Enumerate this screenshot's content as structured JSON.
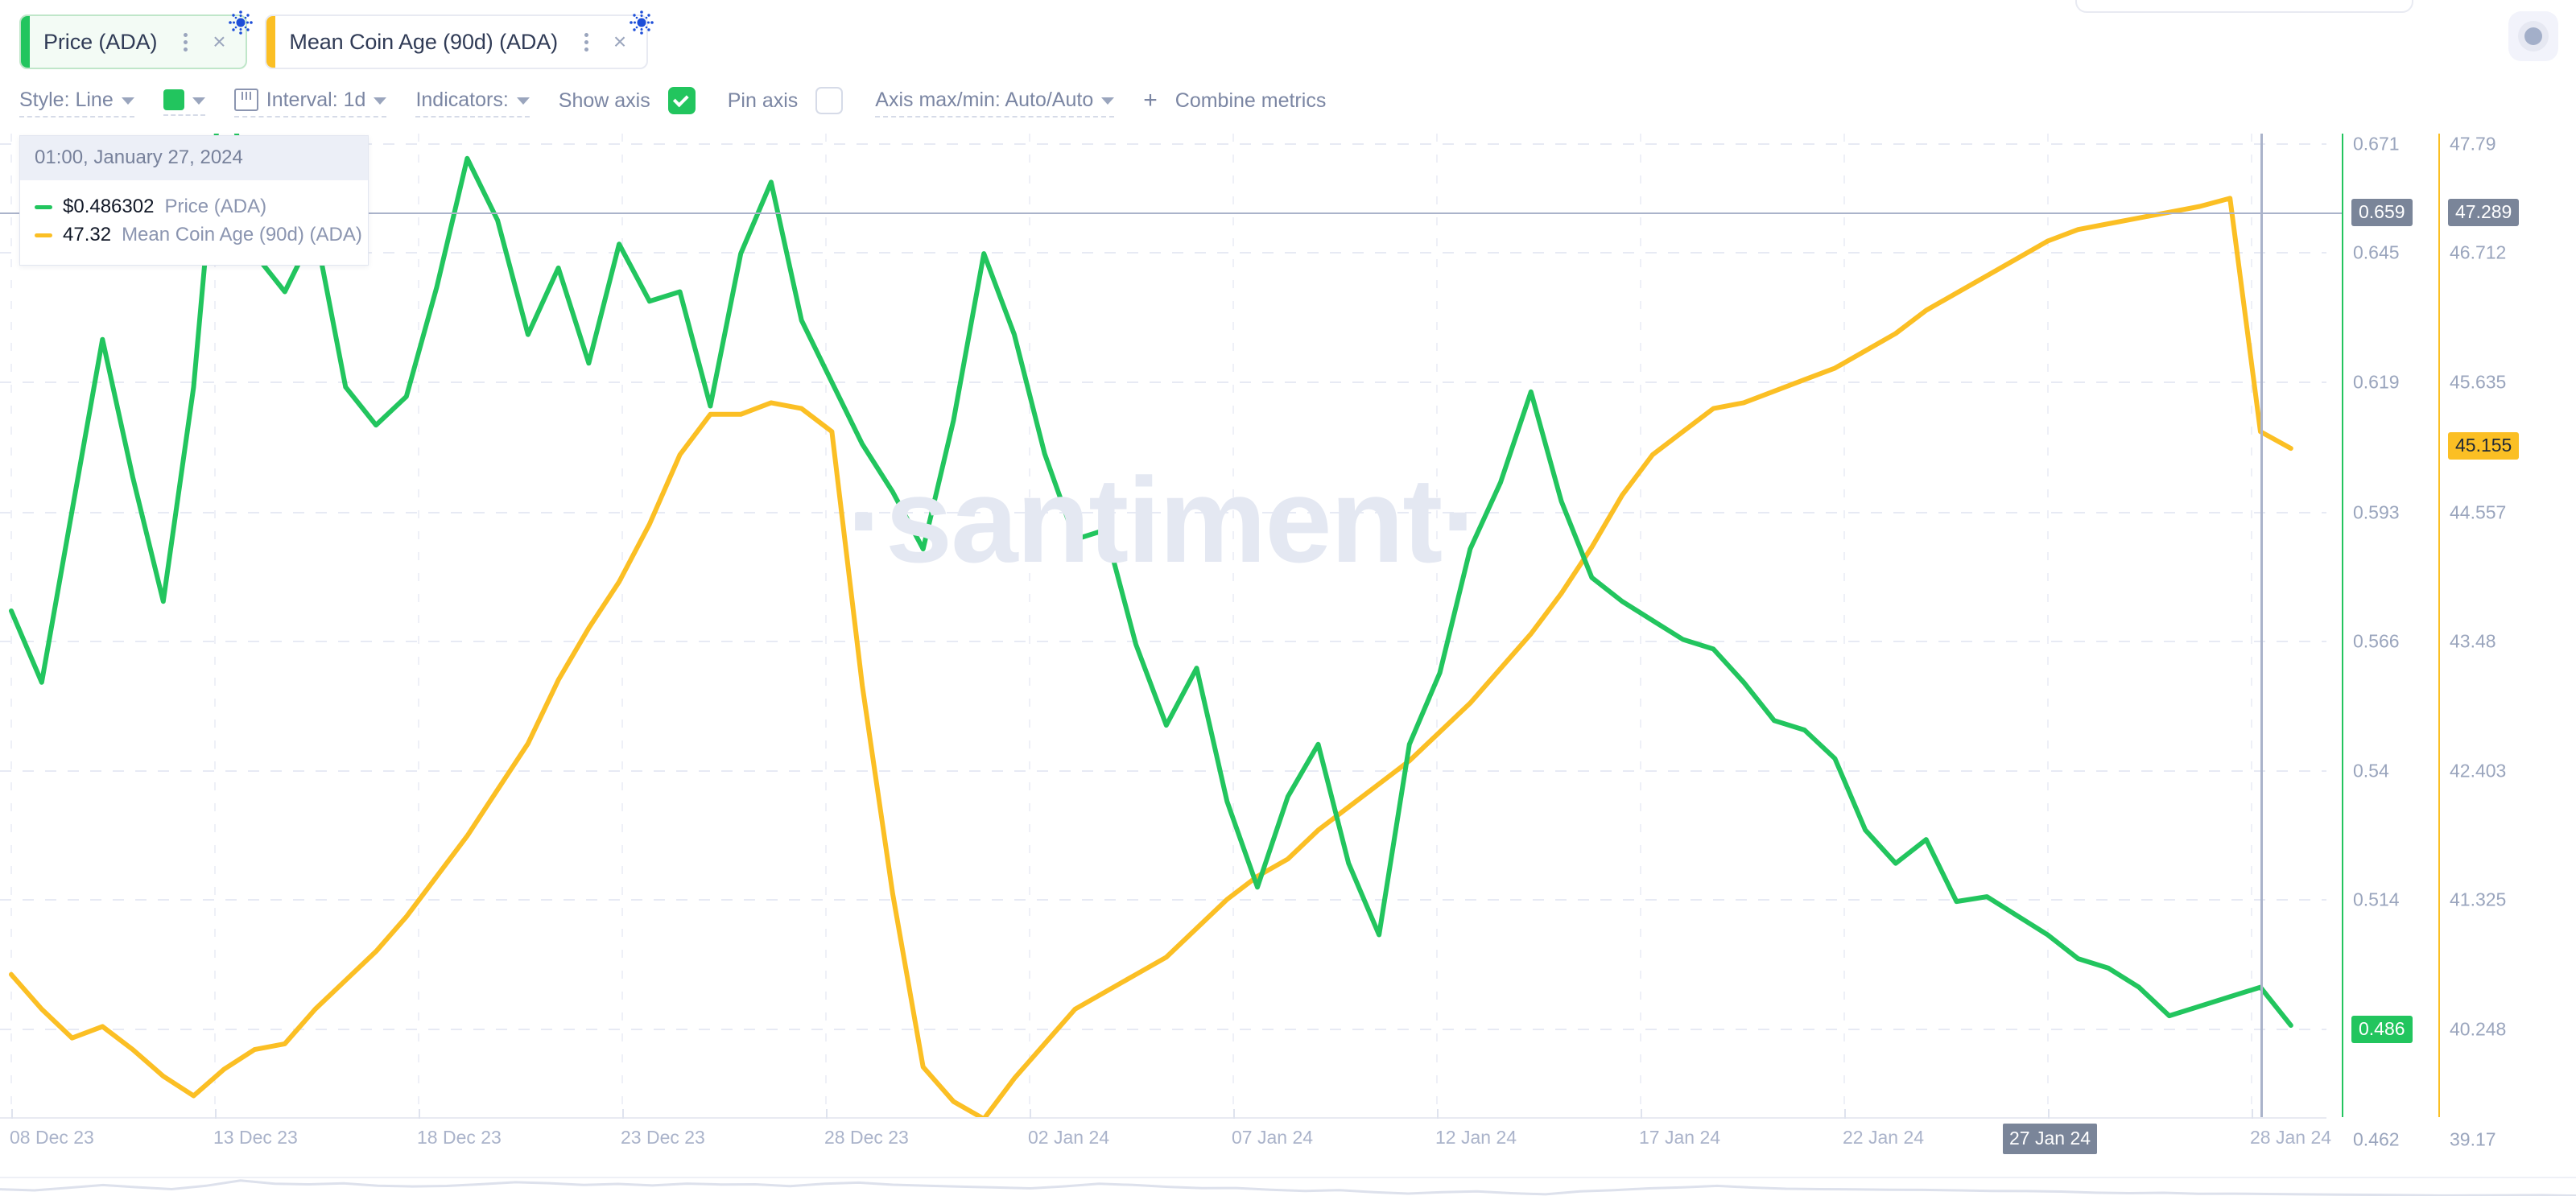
{
  "tabs": [
    {
      "label": "Price (ADA)",
      "color": "#22c55e",
      "active": true,
      "kebab": "kebab-icon",
      "close": "×",
      "sparkle": "sparkle-icon"
    },
    {
      "label": "Mean Coin Age (90d) (ADA)",
      "color": "#fbbf24",
      "active": false,
      "kebab": "kebab-icon",
      "close": "×",
      "sparkle": "sparkle-icon"
    }
  ],
  "toolbar": {
    "style": "Style: Line",
    "color_value": "#22c55e",
    "interval": "Interval: 1d",
    "indicators": "Indicators:",
    "show_axis": "Show axis",
    "show_axis_checked": true,
    "pin_axis": "Pin axis",
    "pin_axis_checked": false,
    "axis_max_min": "Axis max/min: Auto/Auto",
    "combine_metrics": "Combine metrics",
    "plus": "+"
  },
  "tooltip": {
    "datetime": "01:00, January 27, 2024",
    "rows": [
      {
        "value": "$0.486302",
        "name": "Price (ADA)",
        "color": "#22c55e"
      },
      {
        "value": "47.32",
        "name": "Mean Coin Age (90d) (ADA)",
        "color": "#fbbf24"
      }
    ]
  },
  "watermark": "·santiment·",
  "header_button": {
    "name": "account-avatar-button"
  },
  "chart_data": {
    "type": "line",
    "title": "",
    "xlabel": "",
    "ylabel": "",
    "grid": true,
    "legend": "tooltip",
    "x_ticks": [
      "08 Dec 23",
      "13 Dec 23",
      "18 Dec 23",
      "23 Dec 23",
      "28 Dec 23",
      "02 Jan 24",
      "07 Jan 24",
      "12 Jan 24",
      "17 Jan 24",
      "22 Jan 24",
      "27 Jan 24",
      "28 Jan 24"
    ],
    "x_selected": "27 Jan 24",
    "axes": [
      {
        "name": "Price (ADA)",
        "color": "#22c55e",
        "side": "right",
        "ticks": [
          "0.671",
          "0.645",
          "0.619",
          "0.593",
          "0.566",
          "0.54",
          "0.514",
          "0.486",
          "0.462"
        ],
        "ylim": [
          0.462,
          0.671
        ],
        "markers": [
          {
            "value": "0.659",
            "style": "grey"
          },
          {
            "value": "0.486",
            "style": "green"
          }
        ]
      },
      {
        "name": "Mean Coin Age (90d) (ADA)",
        "color": "#fbbf24",
        "side": "right",
        "ticks": [
          "47.79",
          "46.712",
          "45.635",
          "44.557",
          "43.48",
          "42.403",
          "41.325",
          "40.248",
          "39.17"
        ],
        "ylim": [
          39.17,
          47.79
        ],
        "markers": [
          {
            "value": "47.289",
            "style": "grey"
          },
          {
            "value": "45.155",
            "style": "amber"
          }
        ]
      }
    ],
    "series": [
      {
        "name": "Price (ADA)",
        "color": "#22c55e",
        "axis": "Price (ADA)",
        "values": [
          0.573,
          0.558,
          0.594,
          0.63,
          0.601,
          0.575,
          0.62,
          0.691,
          0.648,
          0.64,
          0.653,
          0.62,
          0.612,
          0.618,
          0.641,
          0.668,
          0.655,
          0.631,
          0.645,
          0.625,
          0.65,
          0.638,
          0.64,
          0.616,
          0.648,
          0.663,
          0.634,
          0.621,
          0.608,
          0.598,
          0.586,
          0.613,
          0.648,
          0.631,
          0.606,
          0.588,
          0.59,
          0.566,
          0.549,
          0.561,
          0.533,
          0.515,
          0.534,
          0.545,
          0.52,
          0.505,
          0.545,
          0.56,
          0.586,
          0.6,
          0.619,
          0.596,
          0.58,
          0.575,
          0.571,
          0.567,
          0.565,
          0.558,
          0.55,
          0.548,
          0.542,
          0.527,
          0.52,
          0.525,
          0.512,
          0.513,
          0.509,
          0.505,
          0.5,
          0.498,
          0.494,
          0.488,
          0.49,
          0.492,
          0.494,
          0.486
        ]
      },
      {
        "name": "Mean Coin Age (90d) (ADA)",
        "color": "#fbbf24",
        "axis": "Mean Coin Age (90d) (ADA)",
        "values": [
          40.6,
          40.3,
          40.05,
          40.15,
          39.95,
          39.72,
          39.55,
          39.78,
          39.95,
          40.0,
          40.3,
          40.55,
          40.8,
          41.1,
          41.45,
          41.8,
          42.2,
          42.6,
          43.15,
          43.6,
          44.0,
          44.5,
          45.1,
          45.45,
          45.45,
          45.55,
          45.5,
          45.3,
          43.1,
          41.3,
          39.8,
          39.5,
          39.35,
          39.7,
          40.0,
          40.3,
          40.45,
          40.6,
          40.75,
          41.0,
          41.25,
          41.45,
          41.6,
          41.85,
          42.05,
          42.25,
          42.45,
          42.7,
          42.95,
          43.25,
          43.55,
          43.9,
          44.3,
          44.75,
          45.1,
          45.3,
          45.5,
          45.55,
          45.65,
          45.75,
          45.85,
          46.0,
          46.15,
          46.35,
          46.5,
          46.65,
          46.8,
          46.95,
          47.05,
          47.1,
          47.15,
          47.2,
          47.25,
          47.32,
          45.3,
          45.155
        ]
      }
    ]
  }
}
